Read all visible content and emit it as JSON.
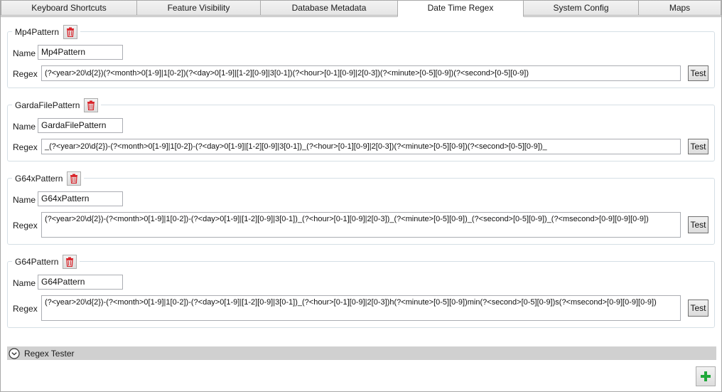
{
  "tabs": [
    {
      "label": "Keyboard Shortcuts"
    },
    {
      "label": "Feature Visibility"
    },
    {
      "label": "Database Metadata"
    },
    {
      "label": "Date Time Regex"
    },
    {
      "label": "System Config"
    },
    {
      "label": "Maps"
    }
  ],
  "active_tab": "Date Time Regex",
  "patterns": [
    {
      "title": "Mp4Pattern",
      "name_label": "Name",
      "name_value": "Mp4Pattern",
      "regex_label": "Regex",
      "regex_value": "(?<year>20\\d{2})(?<month>0[1-9]|1[0-2])(?<day>0[1-9]|[1-2][0-9]|3[0-1])(?<hour>[0-1][0-9]|2[0-3])(?<minute>[0-5][0-9])(?<second>[0-5][0-9])",
      "test_label": "Test"
    },
    {
      "title": "GardaFilePattern",
      "name_label": "Name",
      "name_value": "GardaFilePattern",
      "regex_label": "Regex",
      "regex_value": "_(?<year>20\\d{2})-(?<month>0[1-9]|1[0-2])-(?<day>0[1-9]|[1-2][0-9]|3[0-1])_(?<hour>[0-1][0-9]|2[0-3])(?<minute>[0-5][0-9])(?<second>[0-5][0-9])_",
      "test_label": "Test"
    },
    {
      "title": "G64xPattern",
      "name_label": "Name",
      "name_value": "G64xPattern",
      "regex_label": "Regex",
      "regex_value": "(?<year>20\\d{2})-(?<month>0[1-9]|1[0-2])-(?<day>0[1-9]|[1-2][0-9]|3[0-1])_(?<hour>[0-1][0-9]|2[0-3])_(?<minute>[0-5][0-9])_(?<second>[0-5][0-9])_(?<msecond>[0-9][0-9][0-9])",
      "test_label": "Test"
    },
    {
      "title": "G64Pattern",
      "name_label": "Name",
      "name_value": "G64Pattern",
      "regex_label": "Regex",
      "regex_value": "(?<year>20\\d{2})-(?<month>0[1-9]|1[0-2])-(?<day>0[1-9]|[1-2][0-9]|3[0-1])_(?<hour>[0-1][0-9]|2[0-3])h(?<minute>[0-5][0-9])min(?<second>[0-5][0-9])s(?<msecond>[0-9][0-9][0-9])",
      "test_label": "Test"
    }
  ],
  "regex_tester": {
    "label": "Regex Tester",
    "expanded": false
  },
  "icons": {
    "delete": "trash-icon",
    "expand": "chevron-down-circle-icon",
    "add": "plus-icon"
  },
  "colors": {
    "delete_icon": "#d9252b",
    "add_icon": "#1fa83a",
    "expander_bar": "#d0d0d0"
  }
}
